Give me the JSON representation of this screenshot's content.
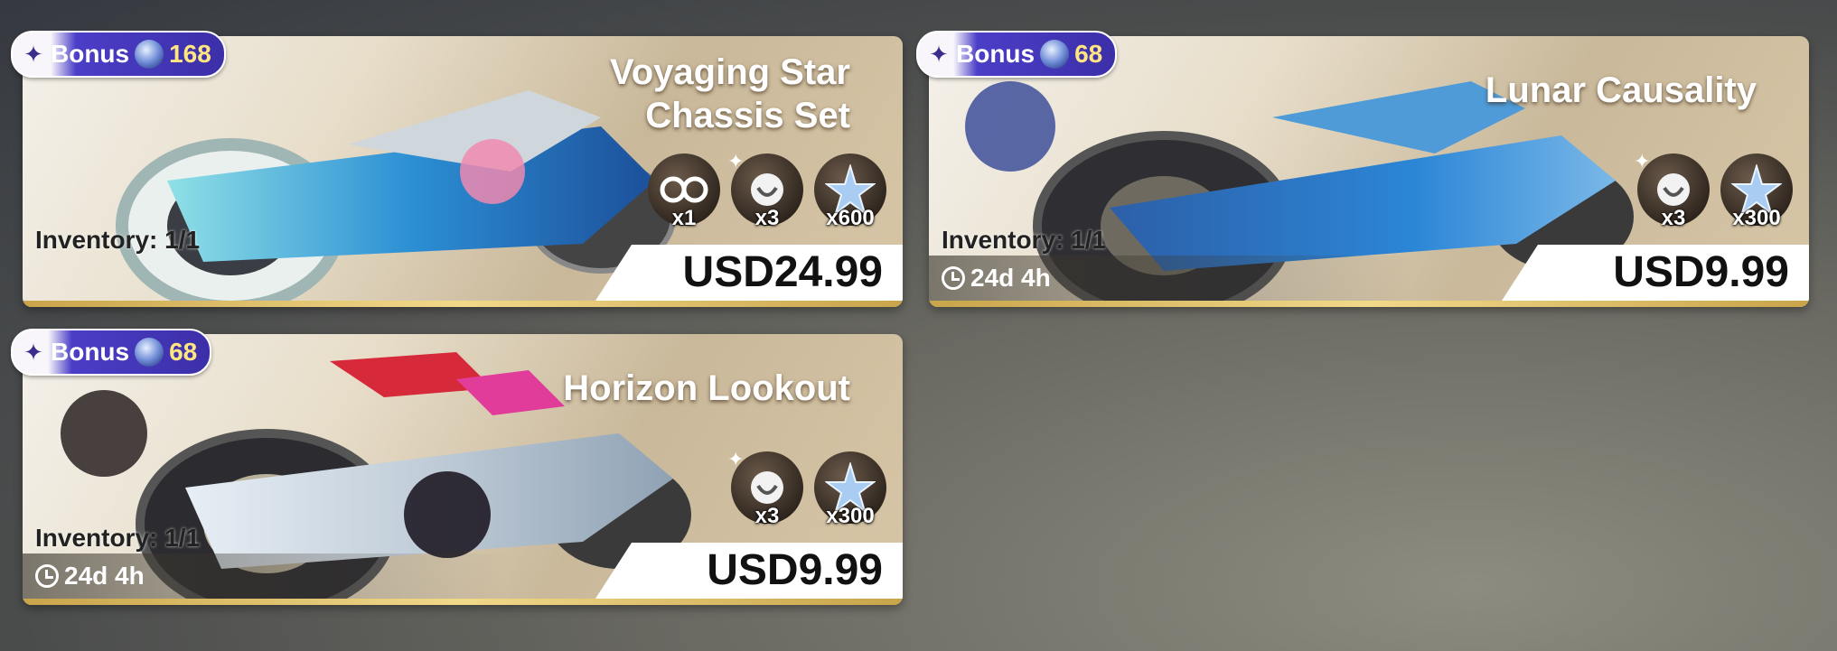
{
  "cards": [
    {
      "title_lines": [
        "Voyaging Star",
        "Chassis Set"
      ],
      "bonus": {
        "label": "Bonus",
        "amount": "168"
      },
      "items": [
        {
          "icon": "goggles-icon",
          "qty": "x1"
        },
        {
          "icon": "boost-token-icon",
          "qty": "x3"
        },
        {
          "icon": "star-crystal-icon",
          "qty": "x600"
        }
      ],
      "inventory": "Inventory: 1/1",
      "price": "USD24.99"
    },
    {
      "title_lines": [
        "Lunar Causality"
      ],
      "bonus": {
        "label": "Bonus",
        "amount": "68"
      },
      "items": [
        {
          "icon": "boost-token-icon",
          "qty": "x3"
        },
        {
          "icon": "star-crystal-icon",
          "qty": "x300"
        }
      ],
      "inventory": "Inventory: 1/1",
      "timer": "24d 4h",
      "price": "USD9.99"
    },
    {
      "title_lines": [
        "Horizon Lookout"
      ],
      "bonus": {
        "label": "Bonus",
        "amount": "68"
      },
      "items": [
        {
          "icon": "boost-token-icon",
          "qty": "x3"
        },
        {
          "icon": "star-crystal-icon",
          "qty": "x300"
        }
      ],
      "inventory": "Inventory: 1/1",
      "timer": "24d 4h",
      "price": "USD9.99"
    }
  ],
  "colors": {
    "bonus_purple": "#3c2fa8",
    "bonus_number": "#ffe680",
    "accent_gold": "#f1d98a"
  }
}
